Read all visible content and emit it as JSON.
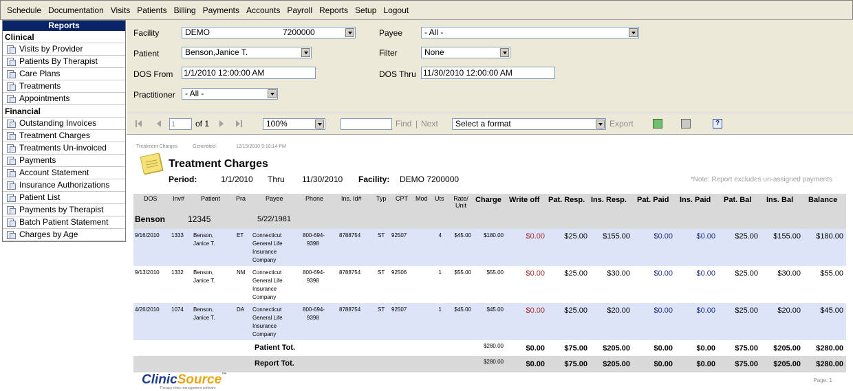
{
  "menu": [
    "Schedule",
    "Documentation",
    "Visits",
    "Patients",
    "Billing",
    "Payments",
    "Accounts",
    "Payroll",
    "Reports",
    "Setup",
    "Logout"
  ],
  "sidebar": {
    "title": "Reports",
    "clinical_label": "Clinical",
    "clinical": [
      "Visits by Provider",
      "Patients By Therapist",
      "Care Plans",
      "Treatments",
      "Appointments"
    ],
    "financial_label": "Financial",
    "financial": [
      "Outstanding Invoices",
      "Treatment Charges",
      "Treatments Un-invoiced",
      "Payments",
      "Account Statement",
      "Insurance Authorizations",
      "Patient List",
      "Payments by Therapist",
      "Batch Patient Statement",
      "Charges by Age"
    ]
  },
  "params": {
    "facility_label": "Facility",
    "facility_name": "DEMO",
    "facility_code": "7200000",
    "payee_label": "Payee",
    "payee_value": "- All -",
    "patient_label": "Patient",
    "patient_value": "Benson,Janice T.",
    "filter_label": "Filter",
    "filter_value": "None",
    "dos_from_label": "DOS From",
    "dos_from_value": "1/1/2010 12:00:00 AM",
    "dos_thru_label": "DOS Thru",
    "dos_thru_value": "11/30/2010 12:00:00 AM",
    "practitioner_label": "Practitioner",
    "practitioner_value": "- All -"
  },
  "toolbar": {
    "page_value": "1",
    "of_text": "of 1",
    "zoom": "100%",
    "find_label": "Find",
    "separator": "|",
    "next_label": "Next",
    "format_value": "Select a format",
    "export_label": "Export"
  },
  "report": {
    "small_name": "Treatment Charges",
    "generated_label": "Generated:",
    "generated_value": "12/15/2010 9:18:14 PM",
    "title": "Treatment Charges",
    "period_label": "Period:",
    "period_from": "1/1/2010",
    "thru_label": "Thru",
    "period_thru": "11/30/2010",
    "facility_label": "Facility:",
    "facility_value": "DEMO 7200000",
    "note": "*Note: Report excludes un-assigned payments",
    "columns": [
      "DOS",
      "Inv#",
      "Patient",
      "Pra",
      "Payee",
      "Phone",
      "Ins. Id#",
      "Typ",
      "CPT",
      "Mod",
      "Uts",
      "Rate/ Unit",
      "Charge",
      "Write off",
      "Pat. Resp.",
      "Ins. Resp.",
      "Pat. Paid",
      "Ins. Paid",
      "Pat. Bal",
      "Ins. Bal",
      "Balance"
    ],
    "patient_group": {
      "name": "Benson",
      "id": "12345",
      "dob": "5/22/1981"
    },
    "rows": [
      {
        "dos": "9/16/2010",
        "inv": "1333",
        "patient": [
          "Benson,",
          "Janice T."
        ],
        "pra": "ET",
        "payee": [
          "Connecticut",
          "General Life",
          "Insurance",
          "Company"
        ],
        "phone": [
          "800-694-",
          "9398"
        ],
        "insid": "8788754",
        "typ": "ST",
        "cpt": "92507",
        "mod": "",
        "uts": "4",
        "rate": "$45.00",
        "charge": "$180.00",
        "writeoff": "$0.00",
        "patresp": "$25.00",
        "insresp": "$155.00",
        "patpaid": "$0.00",
        "inspaid": "$0.00",
        "patbal": "$25.00",
        "insbal": "$155.00",
        "balance": "$180.00"
      },
      {
        "dos": "9/13/2010",
        "inv": "1332",
        "patient": [
          "Benson,",
          "Janice T."
        ],
        "pra": "NM",
        "payee": [
          "Connecticut",
          "General Life",
          "Insurance",
          "Company"
        ],
        "phone": [
          "800-694-",
          "9398"
        ],
        "insid": "8788754",
        "typ": "ST",
        "cpt": "92506",
        "mod": "",
        "uts": "1",
        "rate": "$55.00",
        "charge": "$55.00",
        "writeoff": "$0.00",
        "patresp": "$25.00",
        "insresp": "$30.00",
        "patpaid": "$0.00",
        "inspaid": "$0.00",
        "patbal": "$25.00",
        "insbal": "$30.00",
        "balance": "$55.00"
      },
      {
        "dos": "4/26/2010",
        "inv": "1074",
        "patient": [
          "Benson,",
          "Janice T."
        ],
        "pra": "DA",
        "payee": [
          "Connecticut",
          "General Life",
          "Insurance",
          "Company"
        ],
        "phone": [
          "800-694-",
          "9398"
        ],
        "insid": "8788754",
        "typ": "ST",
        "cpt": "92507",
        "mod": "",
        "uts": "1",
        "rate": "$45.00",
        "charge": "$45.00",
        "writeoff": "$0.00",
        "patresp": "$25.00",
        "insresp": "$20.00",
        "patpaid": "$0.00",
        "inspaid": "$0.00",
        "patbal": "$25.00",
        "insbal": "$20.00",
        "balance": "$45.00"
      }
    ],
    "patient_total": {
      "label": "Patient Tot.",
      "charge": "$280.00",
      "writeoff": "$0.00",
      "patresp": "$75.00",
      "insresp": "$205.00",
      "patpaid": "$0.00",
      "inspaid": "$0.00",
      "patbal": "$75.00",
      "insbal": "$205.00",
      "balance": "$280.00"
    },
    "report_total": {
      "label": "Report Tot.",
      "charge": "$280.00",
      "writeoff": "$0.00",
      "patresp": "$75.00",
      "insresp": "$205.00",
      "patpaid": "$0.00",
      "inspaid": "$0.00",
      "patbal": "$75.00",
      "insbal": "$205.00",
      "balance": "$280.00"
    },
    "logo_part1": "Clinic",
    "logo_part2": "Source",
    "logo_tm": "™",
    "tagline": "Therapy clinic management software",
    "page_label": "Page:",
    "page_value": "1"
  }
}
